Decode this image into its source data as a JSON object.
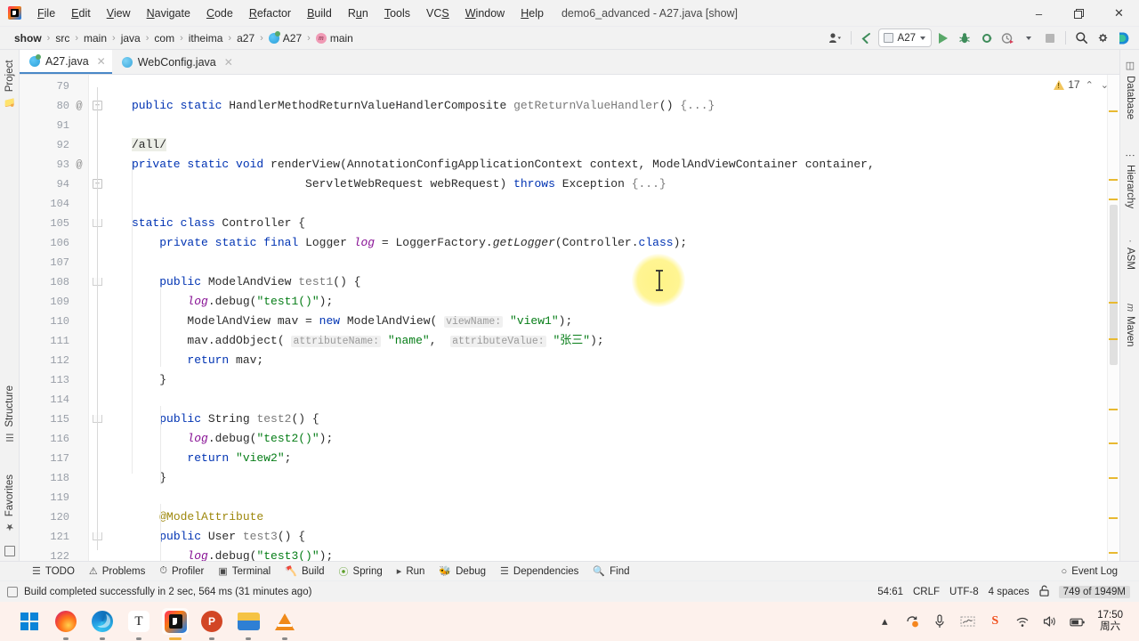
{
  "window": {
    "title": "demo6_advanced - A27.java [show]",
    "minimize": "–",
    "maximize": "❐",
    "close": "✕"
  },
  "menubar": {
    "items": [
      {
        "label": "File"
      },
      {
        "label": "Edit"
      },
      {
        "label": "View"
      },
      {
        "label": "Navigate"
      },
      {
        "label": "Code"
      },
      {
        "label": "Refactor"
      },
      {
        "label": "Build"
      },
      {
        "label": "Run"
      },
      {
        "label": "Tools"
      },
      {
        "label": "VCS"
      },
      {
        "label": "Window"
      },
      {
        "label": "Help"
      }
    ]
  },
  "breadcrumb": {
    "items": [
      "show",
      "src",
      "main",
      "java",
      "com",
      "itheima",
      "a27",
      "A27",
      "main"
    ],
    "separator": "›"
  },
  "toolbar": {
    "run_config": "A27",
    "buttons": [
      "profile-dropdown",
      "back-arrow",
      "run",
      "debug",
      "run-with-coverage",
      "profiler",
      "stop",
      "search-everywhere",
      "settings",
      "ai-assistant"
    ]
  },
  "tabs": [
    {
      "label": "A27.java",
      "active": true,
      "close": "✕"
    },
    {
      "label": "WebConfig.java",
      "active": false,
      "close": "✕"
    }
  ],
  "inspections": {
    "warning_count": "17",
    "up": "⌃",
    "down": "⌄"
  },
  "editor": {
    "lines": [
      {
        "num": "79",
        "gutter": "",
        "tokens": []
      },
      {
        "num": "80",
        "gutter": "@",
        "fold": "+",
        "tokens": [
          {
            "t": "public ",
            "c": "kw"
          },
          {
            "t": "static ",
            "c": "kw"
          },
          {
            "t": "HandlerMethodReturnValueHandlerComposite ",
            "c": "plain"
          },
          {
            "t": "getReturnValueHandler",
            "c": "mth"
          },
          {
            "t": "() ",
            "c": "plain"
          },
          {
            "t": "{...}",
            "c": "mth"
          }
        ]
      },
      {
        "num": "91",
        "gutter": "",
        "tokens": []
      },
      {
        "num": "92",
        "gutter": "",
        "tokens": [
          {
            "t": "/all/",
            "c": "plain hl-url"
          }
        ]
      },
      {
        "num": "93",
        "gutter": "@",
        "tokens": [
          {
            "t": "private ",
            "c": "kw"
          },
          {
            "t": "static ",
            "c": "kw"
          },
          {
            "t": "void ",
            "c": "kw"
          },
          {
            "t": "renderView",
            "c": "mthd"
          },
          {
            "t": "(AnnotationConfigApplicationContext context, ModelAndViewContainer container,",
            "c": "plain"
          }
        ]
      },
      {
        "num": "94",
        "gutter": "",
        "fold": "+",
        "tokens": [
          {
            "t": "                         ServletWebRequest webRequest) ",
            "c": "plain"
          },
          {
            "t": "throws ",
            "c": "kw"
          },
          {
            "t": "Exception ",
            "c": "plain"
          },
          {
            "t": "{...}",
            "c": "mth"
          }
        ]
      },
      {
        "num": "104",
        "gutter": "",
        "tokens": []
      },
      {
        "num": "105",
        "gutter": "",
        "foldend": true,
        "tokens": [
          {
            "t": "static ",
            "c": "kw"
          },
          {
            "t": "class ",
            "c": "kw"
          },
          {
            "t": "Controller ",
            "c": "plain"
          },
          {
            "t": "{",
            "c": "plain"
          }
        ]
      },
      {
        "num": "106",
        "gutter": "",
        "tokens": [
          {
            "t": "    ",
            "c": "plain"
          },
          {
            "t": "private ",
            "c": "kw"
          },
          {
            "t": "static ",
            "c": "kw"
          },
          {
            "t": "final ",
            "c": "kw"
          },
          {
            "t": "Logger ",
            "c": "plain"
          },
          {
            "t": "log",
            "c": "fld"
          },
          {
            "t": " = LoggerFactory.",
            "c": "plain"
          },
          {
            "t": "getLogger",
            "c": "stmth"
          },
          {
            "t": "(Controller.",
            "c": "plain"
          },
          {
            "t": "class",
            "c": "kw"
          },
          {
            "t": ");",
            "c": "plain"
          }
        ]
      },
      {
        "num": "107",
        "gutter": "",
        "tokens": []
      },
      {
        "num": "108",
        "gutter": "",
        "foldend": true,
        "tokens": [
          {
            "t": "    ",
            "c": "plain"
          },
          {
            "t": "public ",
            "c": "kw"
          },
          {
            "t": "ModelAndView ",
            "c": "plain"
          },
          {
            "t": "test1",
            "c": "mth"
          },
          {
            "t": "() {",
            "c": "plain"
          }
        ]
      },
      {
        "num": "109",
        "gutter": "",
        "tokens": [
          {
            "t": "        ",
            "c": "plain"
          },
          {
            "t": "log",
            "c": "fld"
          },
          {
            "t": ".debug(",
            "c": "plain"
          },
          {
            "t": "\"test1()\"",
            "c": "str"
          },
          {
            "t": ");",
            "c": "plain"
          }
        ]
      },
      {
        "num": "110",
        "gutter": "",
        "tokens": [
          {
            "t": "        ",
            "c": "plain"
          },
          {
            "t": "ModelAndView mav = ",
            "c": "plain"
          },
          {
            "t": "new ",
            "c": "kw"
          },
          {
            "t": "ModelAndView( ",
            "c": "plain"
          },
          {
            "t": "viewName:",
            "c": "hint"
          },
          {
            "t": " ",
            "c": "plain"
          },
          {
            "t": "\"view1\"",
            "c": "str"
          },
          {
            "t": ");",
            "c": "plain"
          }
        ]
      },
      {
        "num": "111",
        "gutter": "",
        "tokens": [
          {
            "t": "        ",
            "c": "plain"
          },
          {
            "t": "mav.addObject( ",
            "c": "plain"
          },
          {
            "t": "attributeName:",
            "c": "hint"
          },
          {
            "t": " ",
            "c": "plain"
          },
          {
            "t": "\"name\"",
            "c": "str"
          },
          {
            "t": ",  ",
            "c": "plain"
          },
          {
            "t": "attributeValue:",
            "c": "hint"
          },
          {
            "t": " ",
            "c": "plain"
          },
          {
            "t": "\"张三\"",
            "c": "str"
          },
          {
            "t": ");",
            "c": "plain"
          }
        ]
      },
      {
        "num": "112",
        "gutter": "",
        "tokens": [
          {
            "t": "        ",
            "c": "plain"
          },
          {
            "t": "return ",
            "c": "kw"
          },
          {
            "t": "mav;",
            "c": "plain"
          }
        ]
      },
      {
        "num": "113",
        "gutter": "",
        "foldend2": true,
        "tokens": [
          {
            "t": "    }",
            "c": "plain"
          }
        ]
      },
      {
        "num": "114",
        "gutter": "",
        "tokens": []
      },
      {
        "num": "115",
        "gutter": "",
        "foldend": true,
        "tokens": [
          {
            "t": "    ",
            "c": "plain"
          },
          {
            "t": "public ",
            "c": "kw"
          },
          {
            "t": "String ",
            "c": "plain"
          },
          {
            "t": "test2",
            "c": "mth"
          },
          {
            "t": "() {",
            "c": "plain"
          }
        ]
      },
      {
        "num": "116",
        "gutter": "",
        "tokens": [
          {
            "t": "        ",
            "c": "plain"
          },
          {
            "t": "log",
            "c": "fld"
          },
          {
            "t": ".debug(",
            "c": "plain"
          },
          {
            "t": "\"test2()\"",
            "c": "str"
          },
          {
            "t": ");",
            "c": "plain"
          }
        ]
      },
      {
        "num": "117",
        "gutter": "",
        "tokens": [
          {
            "t": "        ",
            "c": "plain"
          },
          {
            "t": "return ",
            "c": "kw"
          },
          {
            "t": "\"view2\"",
            "c": "str"
          },
          {
            "t": ";",
            "c": "plain"
          }
        ]
      },
      {
        "num": "118",
        "gutter": "",
        "tokens": [
          {
            "t": "    }",
            "c": "plain"
          }
        ]
      },
      {
        "num": "119",
        "gutter": "",
        "tokens": []
      },
      {
        "num": "120",
        "gutter": "",
        "tokens": [
          {
            "t": "    ",
            "c": "plain"
          },
          {
            "t": "@ModelAttribute",
            "c": "ann"
          }
        ]
      },
      {
        "num": "121",
        "gutter": "",
        "foldend": true,
        "tokens": [
          {
            "t": "    ",
            "c": "plain"
          },
          {
            "t": "public ",
            "c": "kw"
          },
          {
            "t": "User ",
            "c": "plain"
          },
          {
            "t": "test3",
            "c": "mth"
          },
          {
            "t": "() {",
            "c": "plain"
          }
        ]
      },
      {
        "num": "122",
        "gutter": "",
        "tokens": [
          {
            "t": "        ",
            "c": "plain"
          },
          {
            "t": "log",
            "c": "fld"
          },
          {
            "t": ".debug(",
            "c": "plain"
          },
          {
            "t": "\"test3()\"",
            "c": "str"
          },
          {
            "t": ");",
            "c": "plain"
          }
        ]
      }
    ]
  },
  "stripe_left": {
    "items": [
      {
        "label": "Project",
        "icon": "folder-icon"
      },
      {
        "label": "Structure",
        "icon": "structure-icon"
      },
      {
        "label": "Favorites",
        "icon": "star-icon"
      }
    ]
  },
  "stripe_right": {
    "items": [
      {
        "label": "Database",
        "icon": "database-icon"
      },
      {
        "label": "Hierarchy",
        "icon": "hierarchy-icon"
      },
      {
        "label": "ASM",
        "icon": "asm-icon"
      },
      {
        "label": "Maven",
        "icon": "maven-icon"
      }
    ]
  },
  "bottombar": {
    "left": [
      {
        "label": "TODO",
        "icon": "todo-icon"
      },
      {
        "label": "Problems",
        "icon": "problems-icon"
      },
      {
        "label": "Profiler",
        "icon": "profiler-icon"
      },
      {
        "label": "Terminal",
        "icon": "terminal-icon"
      },
      {
        "label": "Build",
        "icon": "build-icon"
      },
      {
        "label": "Spring",
        "icon": "spring-icon"
      },
      {
        "label": "Run",
        "icon": "run-icon"
      },
      {
        "label": "Debug",
        "icon": "debug-icon"
      },
      {
        "label": "Dependencies",
        "icon": "dependencies-icon"
      },
      {
        "label": "Find",
        "icon": "find-icon"
      }
    ],
    "right": {
      "label": "Event Log",
      "icon": "event-log-icon"
    }
  },
  "statusbar": {
    "message": "Build completed successfully in 2 sec, 564 ms (31 minutes ago)",
    "caret": "54:61",
    "line_separator": "CRLF",
    "encoding": "UTF-8",
    "indent": "4 spaces",
    "lock_icon": "lock-icon",
    "memory": "749 of 1949M"
  },
  "taskbar": {
    "items": [
      {
        "name": "start-button",
        "icon": "windows-logo"
      },
      {
        "name": "firefox",
        "icon": "firefox-icon"
      },
      {
        "name": "edge",
        "icon": "edge-icon"
      },
      {
        "name": "typora",
        "icon": "typora-icon"
      },
      {
        "name": "intellij-idea",
        "icon": "intellij-icon",
        "active": true
      },
      {
        "name": "powerpoint",
        "icon": "powerpoint-icon"
      },
      {
        "name": "file-explorer",
        "icon": "folder-icon"
      },
      {
        "name": "vlc",
        "icon": "vlc-icon"
      }
    ],
    "tray": [
      {
        "name": "show-hidden-icons",
        "icon": "chevron-up-icon"
      },
      {
        "name": "sync-icon",
        "icon": "sync-icon"
      },
      {
        "name": "microphone",
        "icon": "mic-icon"
      },
      {
        "name": "ime-handwriting",
        "icon": "handwriting-icon"
      },
      {
        "name": "sogou-ime",
        "icon": "sogou-icon"
      },
      {
        "name": "network",
        "icon": "wifi-icon"
      },
      {
        "name": "volume",
        "icon": "speaker-icon"
      },
      {
        "name": "battery",
        "icon": "battery-icon"
      }
    ],
    "clock_time": "17:50",
    "clock_date": "周六"
  }
}
